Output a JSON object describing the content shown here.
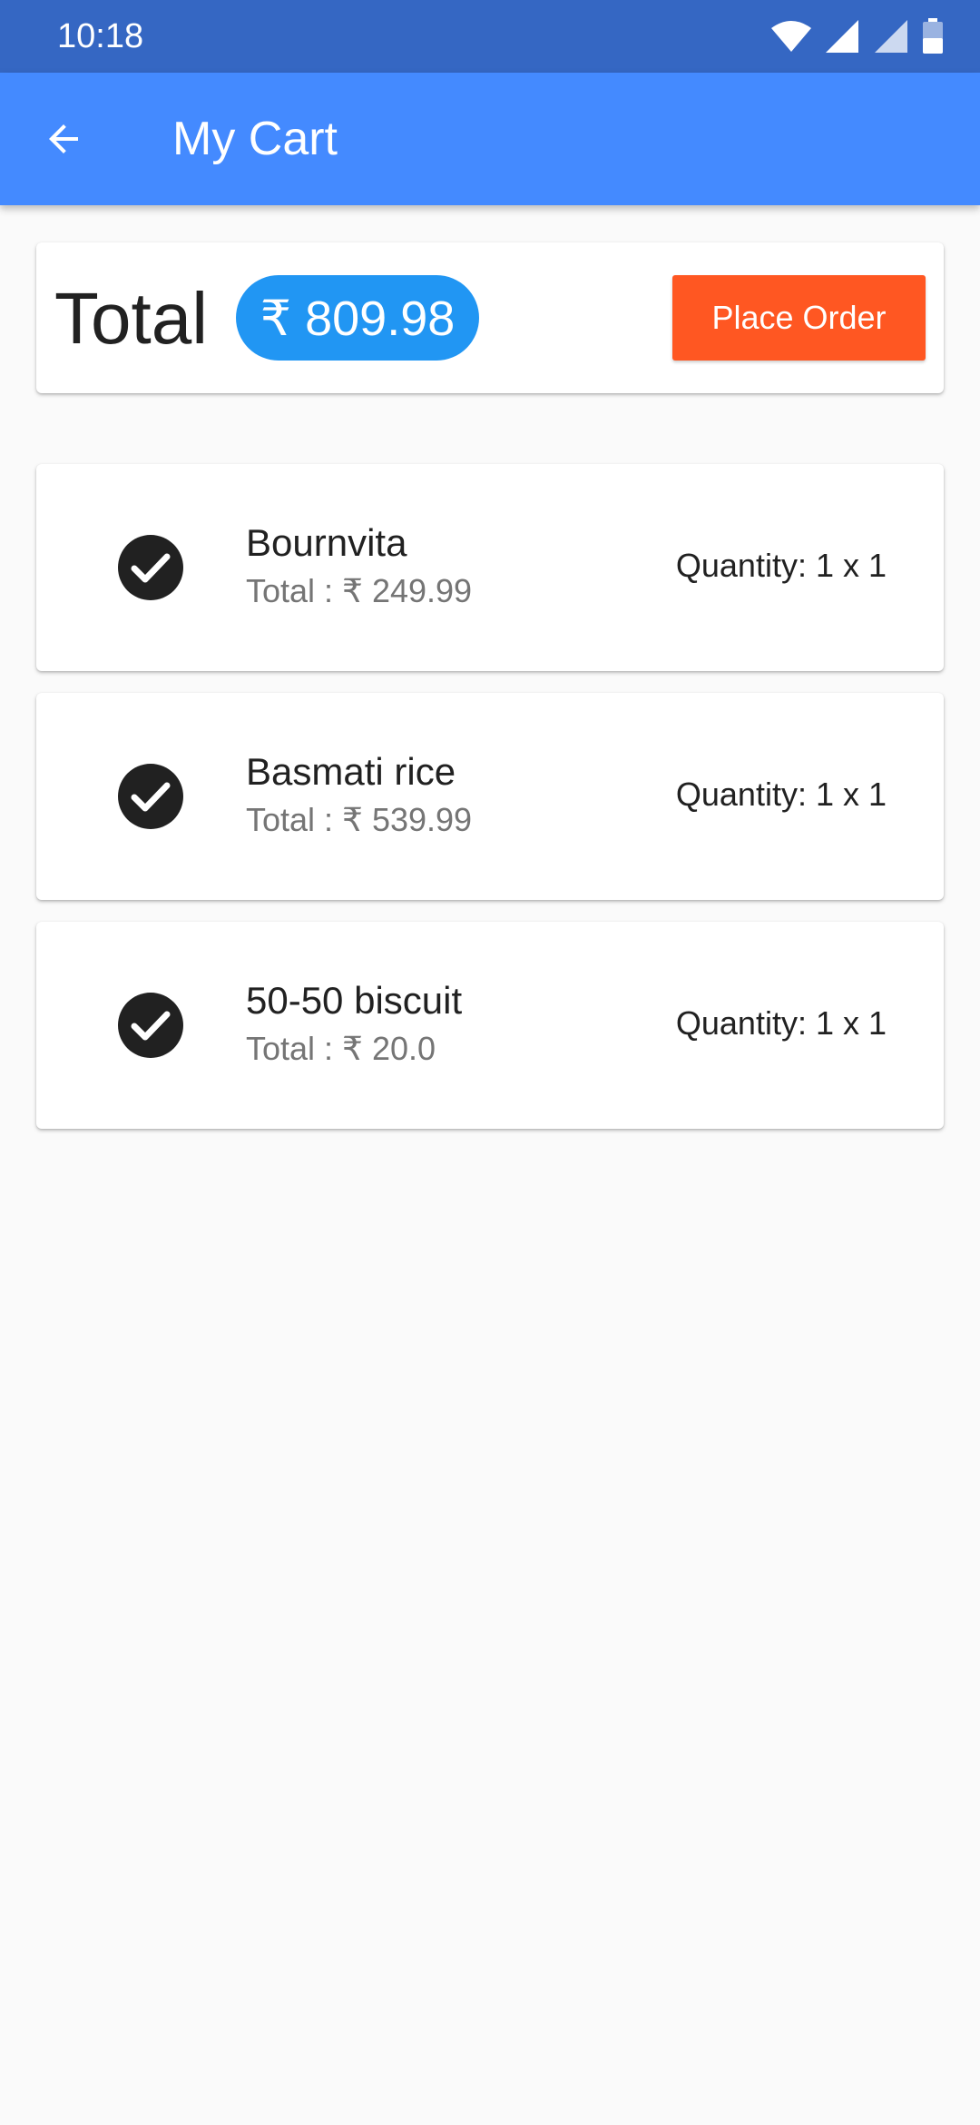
{
  "status_bar": {
    "time": "10:18",
    "icons": [
      "wifi-icon",
      "signal-icon",
      "signal-icon",
      "battery-icon"
    ]
  },
  "app_bar": {
    "back_icon": "arrow-back-icon",
    "title": "My Cart"
  },
  "summary": {
    "total_label": "Total",
    "total_amount": "₹ 809.98",
    "place_order_label": "Place Order"
  },
  "items": [
    {
      "name": "Bournvita",
      "total": "Total : ₹ 249.99",
      "quantity": "Quantity: 1 x 1",
      "icon": "check-circle-icon"
    },
    {
      "name": "Basmati rice",
      "total": "Total : ₹ 539.99",
      "quantity": "Quantity: 1 x 1",
      "icon": "check-circle-icon"
    },
    {
      "name": "50-50 biscuit",
      "total": "Total : ₹ 20.0",
      "quantity": "Quantity: 1 x 1",
      "icon": "check-circle-icon"
    }
  ],
  "colors": {
    "status_bar": "#3567c3",
    "app_bar": "#448aff",
    "total_pill": "#2196f3",
    "place_order": "#ff5722",
    "background": "#fafafa"
  }
}
